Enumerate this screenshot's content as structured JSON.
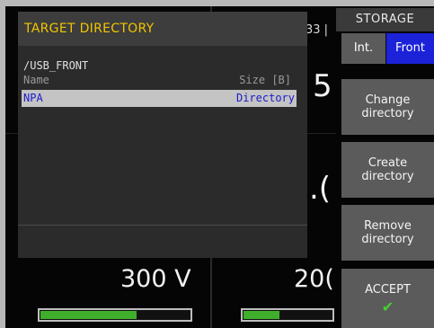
{
  "colors": {
    "title_yellow": "#f1c500",
    "selected_blue": "#1b22d8",
    "row_text_blue": "#1a1acc",
    "accept_green": "#43d12b",
    "bar_green": "#3fae2a"
  },
  "background": {
    "top_fragment": "33 |",
    "digit_five": "5",
    "digit_fragment": ".(",
    "voltage_left": "300 V",
    "voltage_right": "20(",
    "bar_left_level": 0.65,
    "bar_right_level": 0.42
  },
  "menu": {
    "title": "STORAGE",
    "tab_int": "Int.",
    "tab_front": "Front",
    "change_directory": "Change\ndirectory",
    "create_directory": "Create\ndirectory",
    "remove_directory": "Remove\ndirectory",
    "accept": "ACCEPT",
    "accept_icon": "check-icon"
  },
  "dialog": {
    "title": "TARGET DIRECTORY",
    "path": "/USB_FRONT",
    "col_name": "Name",
    "col_size": "Size [B]",
    "rows": [
      {
        "name": "NPA",
        "size": "Directory",
        "selected": true
      }
    ]
  }
}
